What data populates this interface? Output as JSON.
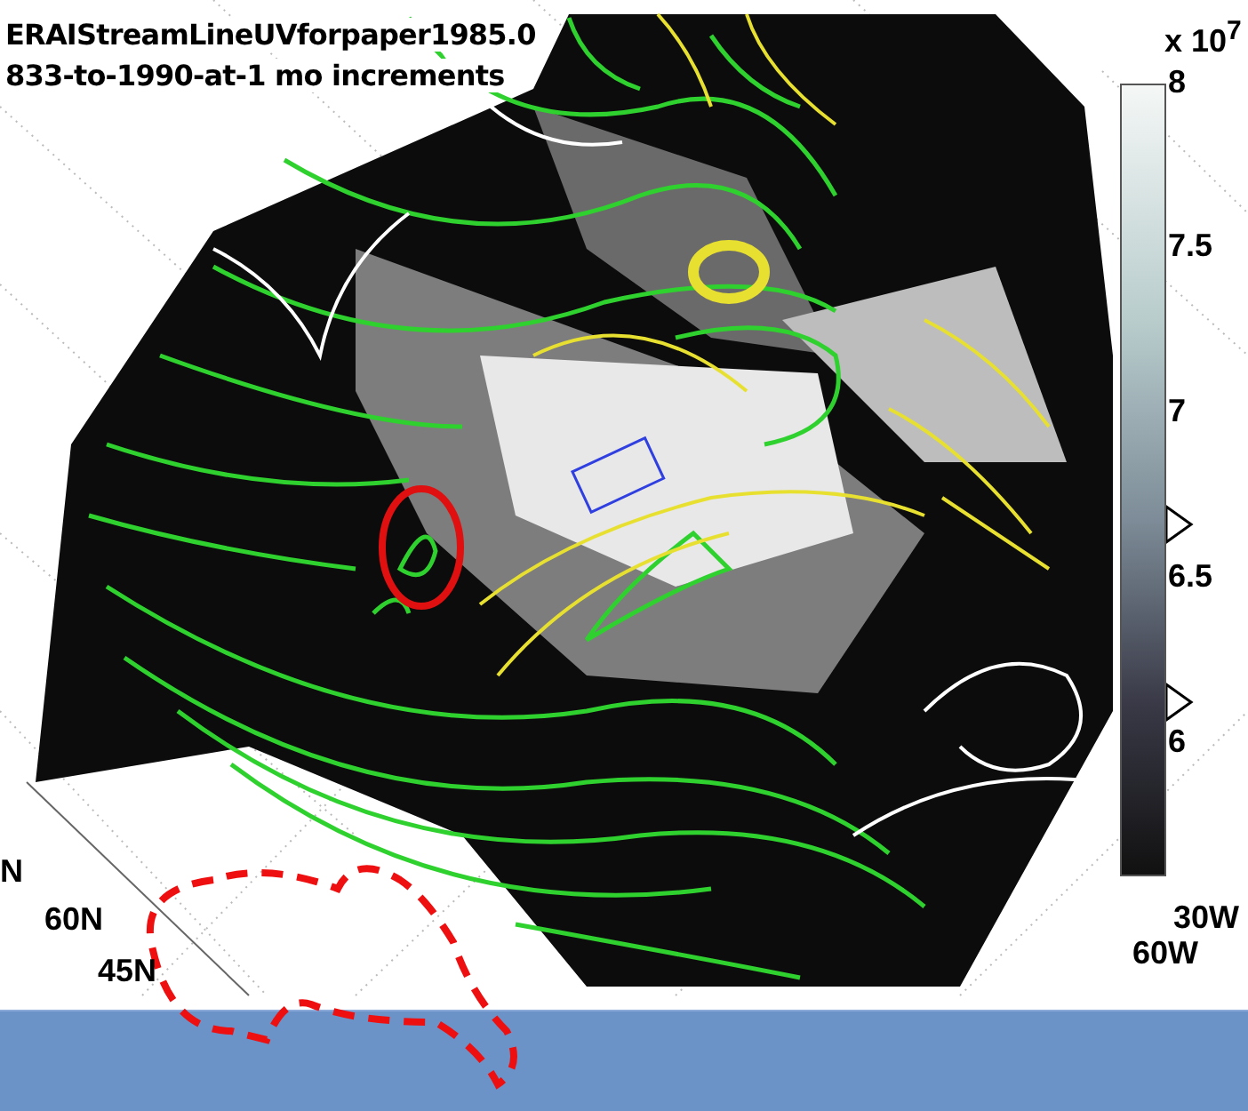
{
  "figure": {
    "title_lines": [
      "ERAIStreamLineUVforpaper1985.0",
      "833-to-1990-at-1 mo increments"
    ]
  },
  "colorbar": {
    "multiplier": "x 10$^{7}$",
    "ticks": [
      "8",
      "7.5",
      "7",
      "6.5",
      "6"
    ]
  },
  "map": {
    "lat_labels": [
      "N",
      "60N",
      "45N"
    ],
    "lon_labels": [
      "30W",
      "60W"
    ]
  }
}
